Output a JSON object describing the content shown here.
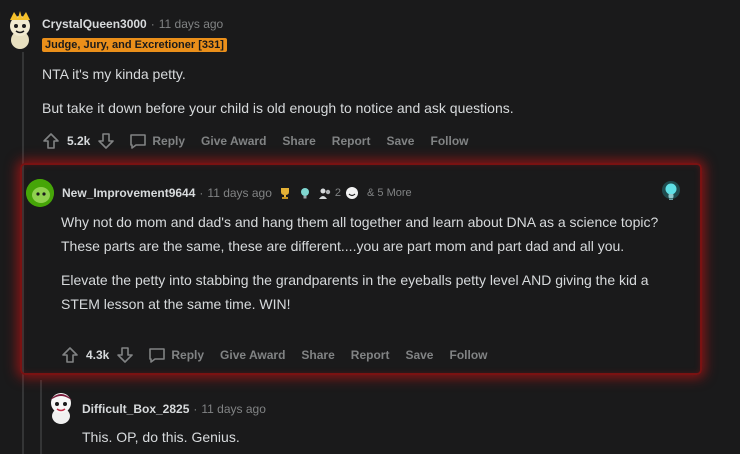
{
  "comments": [
    {
      "username": "CrystalQueen3000",
      "time": "11 days ago",
      "flair": "Judge, Jury, and Excretioner [331]",
      "paragraphs": [
        "NTA it's my kinda petty.",
        "But take it down before your child is old enough to notice and ask questions."
      ],
      "score": "5.2k",
      "actions": {
        "reply": "Reply",
        "give_award": "Give Award",
        "share": "Share",
        "report": "Report",
        "save": "Save",
        "follow": "Follow"
      }
    },
    {
      "username": "New_Improvement9644",
      "time": "11 days ago",
      "award_count": "2",
      "more_awards": "& 5 More",
      "paragraphs": [
        "Why not do mom and dad's and hang them all together and learn about DNA as a science topic? These parts are the same, these are different....you are part mom and part dad and all you.",
        "Elevate the petty into stabbing the grandparents in the eyeballs petty level AND giving the kid a STEM lesson at the same time. WIN!"
      ],
      "score": "4.3k",
      "actions": {
        "reply": "Reply",
        "give_award": "Give Award",
        "share": "Share",
        "report": "Report",
        "save": "Save",
        "follow": "Follow"
      }
    },
    {
      "username": "Difficult_Box_2825",
      "time": "11 days ago",
      "paragraphs": [
        "This. OP, do this. Genius."
      ]
    }
  ],
  "colors": {
    "background": "#1a1a1b",
    "flair": "#ea8f1a",
    "highlight_border": "#7a1212",
    "muted_text": "#818384",
    "text": "#d7dadc"
  }
}
